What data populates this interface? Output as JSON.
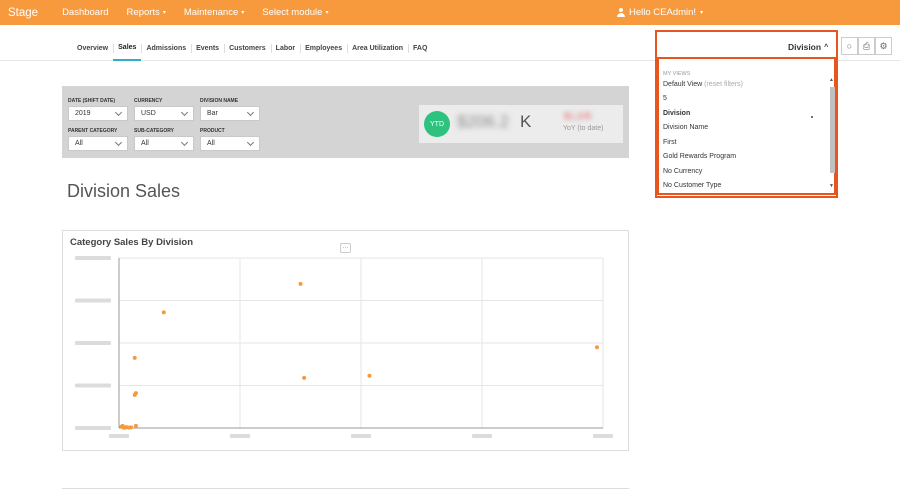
{
  "topbar": {
    "brand": "Stage",
    "nav": [
      {
        "label": "Dashboard"
      },
      {
        "label": "Reports"
      },
      {
        "label": "Maintenance"
      },
      {
        "label": "Select module"
      }
    ],
    "user_label": "Hello CEAdmin!",
    "caret": "▾"
  },
  "subnav": {
    "tabs": [
      {
        "label": "Overview"
      },
      {
        "label": "Sales",
        "active": true
      },
      {
        "label": "Admissions"
      },
      {
        "label": "Events"
      },
      {
        "label": "Customers"
      },
      {
        "label": "Labor"
      },
      {
        "label": "Employees"
      },
      {
        "label": "Area Utilization"
      },
      {
        "label": "FAQ"
      }
    ],
    "view_label": "Division",
    "view_caret": "^"
  },
  "icons": {
    "chat": "○",
    "print": "⎙",
    "settings": "⚙"
  },
  "filters": {
    "date_label": "DATE (SHIFT DATE)",
    "date_value": "2019",
    "currency_label": "CURRENCY",
    "currency_value": "USD",
    "division_label": "DIVISION NAME",
    "division_value": "Bar",
    "parent_label": "PARENT CATEGORY",
    "parent_value": "All",
    "sub_label": "SUB-CATEGORY",
    "sub_value": "All",
    "product_label": "PRODUCT",
    "product_value": "All"
  },
  "kpi": {
    "badge": "YTD",
    "value": "$206.2",
    "unit": "K",
    "yoy_value": "$1,105",
    "yoy_label": "YoY (to date)"
  },
  "page_title": "Division Sales",
  "chart": {
    "title": "Category Sales By Division",
    "more": "···"
  },
  "chart_data": {
    "type": "scatter",
    "title": "Category Sales By Division",
    "color": "#f79a3e",
    "xlim": [
      0,
      40
    ],
    "ylim": [
      0,
      40
    ],
    "points": [
      {
        "x": 0.2,
        "y": 0.3
      },
      {
        "x": 0.4,
        "y": 0.1
      },
      {
        "x": 0.6,
        "y": 0.2
      },
      {
        "x": 0.8,
        "y": 0.1
      },
      {
        "x": 0.3,
        "y": 0.5
      },
      {
        "x": 1.0,
        "y": 0.15
      },
      {
        "x": 0.5,
        "y": 0.05
      },
      {
        "x": 1.3,
        "y": 16.5
      },
      {
        "x": 1.4,
        "y": 8.2
      },
      {
        "x": 1.3,
        "y": 7.8
      },
      {
        "x": 1.4,
        "y": 0.5
      },
      {
        "x": 3.7,
        "y": 27.2
      },
      {
        "x": 15.0,
        "y": 33.9
      },
      {
        "x": 15.3,
        "y": 11.8
      },
      {
        "x": 20.7,
        "y": 12.3
      },
      {
        "x": 39.5,
        "y": 19.0
      }
    ]
  },
  "dropdown": {
    "heading": "MY VIEWS",
    "items": [
      {
        "label": "Default View",
        "hint": "(reset filters)"
      },
      {
        "label": "5"
      },
      {
        "label": "Division",
        "bold": true
      },
      {
        "label": "Division Name"
      },
      {
        "label": "First"
      },
      {
        "label": "Gold Rewards Program"
      },
      {
        "label": "No Currency"
      },
      {
        "label": "No Customer Type"
      }
    ],
    "scroll_up": "▲",
    "scroll_down": "▼"
  }
}
